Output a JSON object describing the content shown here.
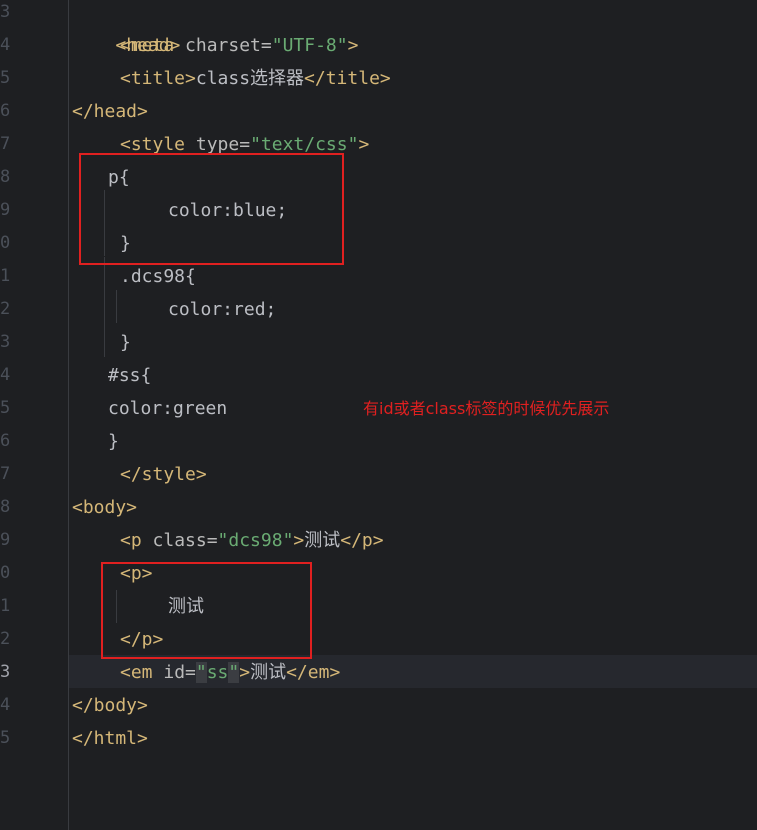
{
  "editor": {
    "line_numbers": [
      "3",
      "4",
      "5",
      "6",
      "7",
      "8",
      "9",
      "0",
      "1",
      "2",
      "3",
      "4",
      "5",
      "6",
      "7",
      "8",
      "9",
      "0",
      "1",
      "2",
      "3",
      "4",
      "5"
    ],
    "active_line": "3"
  },
  "code": {
    "l1_head_open": "<head>",
    "l2_meta_open": "<meta",
    "l2_charset_attr": " charset=",
    "l2_charset_val": "\"UTF-8\"",
    "l2_meta_close": ">",
    "l3_title_open": "<title>",
    "l3_title_text": "class选择器",
    "l3_title_close": "</title>",
    "l4_head_close": "</head>",
    "l5_style_open": "<style",
    "l5_type_attr": " type=",
    "l5_type_val": "\"text/css\"",
    "l5_style_close": ">",
    "l6_p_selector": "p{",
    "l7_color_blue": "color:blue;",
    "l8_brace": "}",
    "l9_dcs_selector": ".dcs98{",
    "l10_color_red": "color:red;",
    "l11_brace": "}",
    "l12_ss_selector": "#ss{",
    "l13_color_green": "color:green",
    "l14_brace": "}",
    "l15_style_end": "</style>",
    "l16_body_open": "<body>",
    "l17_p_open": "<p",
    "l17_class_attr": " class=",
    "l17_class_val": "\"dcs98\"",
    "l17_gt": ">",
    "l17_text": "测试",
    "l17_p_close": "</p>",
    "l18_p_open": "<p>",
    "l19_text": "测试",
    "l20_p_close": "</p>",
    "l21_em_open": "<em",
    "l21_id_attr": " id=",
    "l21_quote1": "\"",
    "l21_id_val": "ss",
    "l21_quote2": "\"",
    "l21_gt": ">",
    "l21_text": "测试",
    "l21_em_close": "</em>",
    "l22_body_close": "</body>",
    "l23_html_close": "</html>"
  },
  "annotation": {
    "text": "有id或者class标签的时候优先展示",
    "color": "#e02020"
  },
  "colors": {
    "background": "#1e1f22",
    "tag": "#d5b778",
    "string": "#6aab73",
    "text": "#bcbec4",
    "highlight_box": "#e02020"
  }
}
